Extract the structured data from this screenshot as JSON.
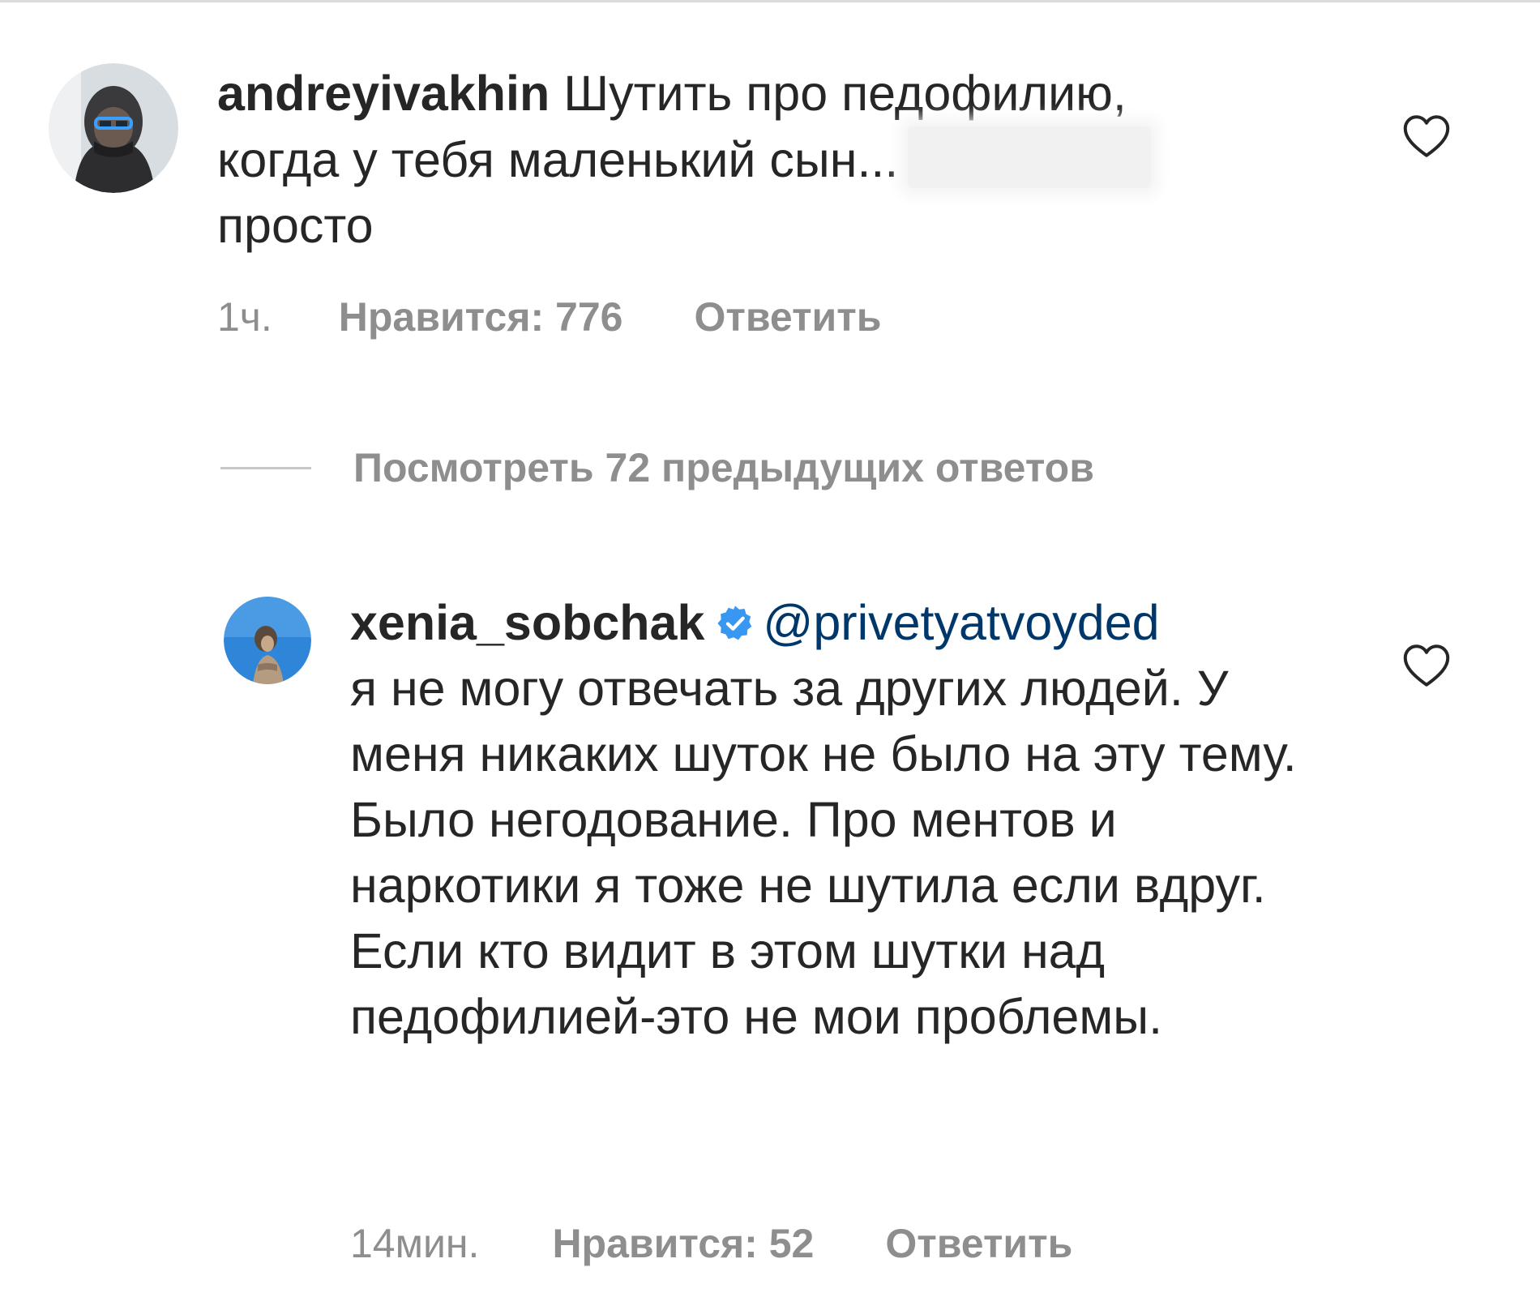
{
  "comments": [
    {
      "username": "andreyivakhin",
      "text_line1": "Шутить про педофилию,",
      "text_line2": "когда у тебя маленький сын...",
      "text_line3": "просто",
      "time": "1ч.",
      "likes": "Нравится: 776",
      "reply": "Ответить",
      "avatar_icon": "user-avatar-hooded-sunglasses",
      "like_icon": "heart-outline-icon"
    },
    {
      "username": "xenia_sobchak",
      "verified_icon": "verified-badge-icon",
      "mention": "@privetyatvoyded",
      "text": "я не могу отвечать за других людей. У меня никаких шуток не было на эту тему. Было негодование. Про ментов и наркотики я тоже не шутила если вдруг. Если кто видит в этом шутки над педофилией-это не мои проблемы.",
      "time": "14мин.",
      "likes": "Нравится: 52",
      "reply": "Ответить",
      "avatar_icon": "user-avatar-blue-sky",
      "like_icon": "heart-outline-icon"
    }
  ],
  "view_replies": {
    "label": "Посмотреть 72 предыдущих ответов"
  },
  "colors": {
    "text": "#262626",
    "secondary": "#8e8e8e",
    "mention": "#00376b",
    "verified": "#3897f0"
  }
}
